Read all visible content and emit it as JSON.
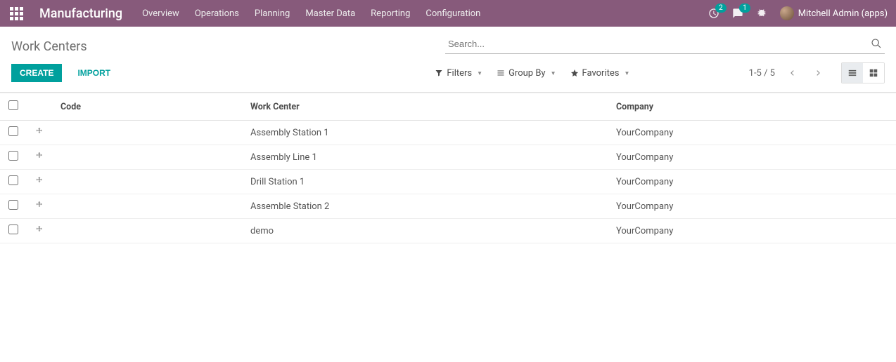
{
  "nav": {
    "brand": "Manufacturing",
    "menu": [
      "Overview",
      "Operations",
      "Planning",
      "Master Data",
      "Reporting",
      "Configuration"
    ],
    "activities_count": "2",
    "discuss_count": "1",
    "user": "Mitchell Admin (apps)"
  },
  "cp": {
    "breadcrumb": "Work Centers",
    "search_placeholder": "Search...",
    "create": "Create",
    "import": "Import",
    "filters": "Filters",
    "groupby": "Group By",
    "favorites": "Favorites",
    "pager": "1-5 / 5"
  },
  "table": {
    "headers": {
      "code": "Code",
      "work_center": "Work Center",
      "company": "Company"
    },
    "rows": [
      {
        "code": "",
        "work_center": "Assembly Station 1",
        "company": "YourCompany"
      },
      {
        "code": "",
        "work_center": "Assembly Line 1",
        "company": "YourCompany"
      },
      {
        "code": "",
        "work_center": "Drill Station 1",
        "company": "YourCompany"
      },
      {
        "code": "",
        "work_center": "Assemble Station 2",
        "company": "YourCompany"
      },
      {
        "code": "",
        "work_center": "demo",
        "company": "YourCompany"
      }
    ]
  }
}
